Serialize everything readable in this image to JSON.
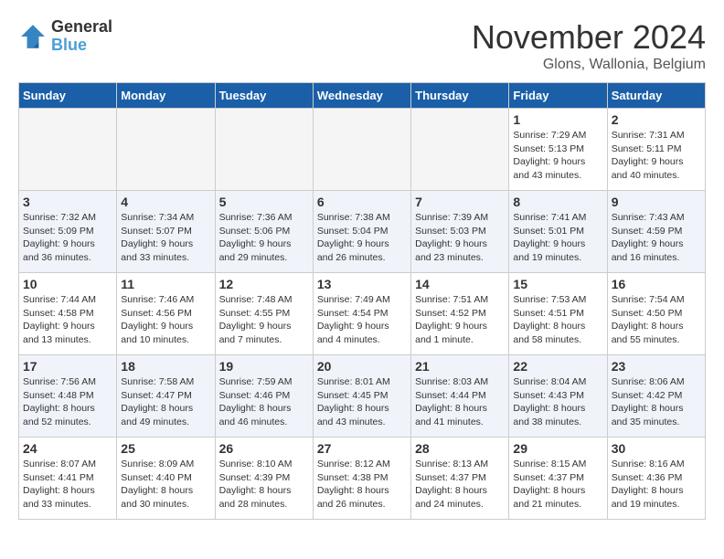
{
  "header": {
    "logo_line1": "General",
    "logo_line2": "Blue",
    "month_title": "November 2024",
    "subtitle": "Glons, Wallonia, Belgium"
  },
  "days_of_week": [
    "Sunday",
    "Monday",
    "Tuesday",
    "Wednesday",
    "Thursday",
    "Friday",
    "Saturday"
  ],
  "weeks": [
    [
      {
        "num": "",
        "info": ""
      },
      {
        "num": "",
        "info": ""
      },
      {
        "num": "",
        "info": ""
      },
      {
        "num": "",
        "info": ""
      },
      {
        "num": "",
        "info": ""
      },
      {
        "num": "1",
        "info": "Sunrise: 7:29 AM\nSunset: 5:13 PM\nDaylight: 9 hours\nand 43 minutes."
      },
      {
        "num": "2",
        "info": "Sunrise: 7:31 AM\nSunset: 5:11 PM\nDaylight: 9 hours\nand 40 minutes."
      }
    ],
    [
      {
        "num": "3",
        "info": "Sunrise: 7:32 AM\nSunset: 5:09 PM\nDaylight: 9 hours\nand 36 minutes."
      },
      {
        "num": "4",
        "info": "Sunrise: 7:34 AM\nSunset: 5:07 PM\nDaylight: 9 hours\nand 33 minutes."
      },
      {
        "num": "5",
        "info": "Sunrise: 7:36 AM\nSunset: 5:06 PM\nDaylight: 9 hours\nand 29 minutes."
      },
      {
        "num": "6",
        "info": "Sunrise: 7:38 AM\nSunset: 5:04 PM\nDaylight: 9 hours\nand 26 minutes."
      },
      {
        "num": "7",
        "info": "Sunrise: 7:39 AM\nSunset: 5:03 PM\nDaylight: 9 hours\nand 23 minutes."
      },
      {
        "num": "8",
        "info": "Sunrise: 7:41 AM\nSunset: 5:01 PM\nDaylight: 9 hours\nand 19 minutes."
      },
      {
        "num": "9",
        "info": "Sunrise: 7:43 AM\nSunset: 4:59 PM\nDaylight: 9 hours\nand 16 minutes."
      }
    ],
    [
      {
        "num": "10",
        "info": "Sunrise: 7:44 AM\nSunset: 4:58 PM\nDaylight: 9 hours\nand 13 minutes."
      },
      {
        "num": "11",
        "info": "Sunrise: 7:46 AM\nSunset: 4:56 PM\nDaylight: 9 hours\nand 10 minutes."
      },
      {
        "num": "12",
        "info": "Sunrise: 7:48 AM\nSunset: 4:55 PM\nDaylight: 9 hours\nand 7 minutes."
      },
      {
        "num": "13",
        "info": "Sunrise: 7:49 AM\nSunset: 4:54 PM\nDaylight: 9 hours\nand 4 minutes."
      },
      {
        "num": "14",
        "info": "Sunrise: 7:51 AM\nSunset: 4:52 PM\nDaylight: 9 hours\nand 1 minute."
      },
      {
        "num": "15",
        "info": "Sunrise: 7:53 AM\nSunset: 4:51 PM\nDaylight: 8 hours\nand 58 minutes."
      },
      {
        "num": "16",
        "info": "Sunrise: 7:54 AM\nSunset: 4:50 PM\nDaylight: 8 hours\nand 55 minutes."
      }
    ],
    [
      {
        "num": "17",
        "info": "Sunrise: 7:56 AM\nSunset: 4:48 PM\nDaylight: 8 hours\nand 52 minutes."
      },
      {
        "num": "18",
        "info": "Sunrise: 7:58 AM\nSunset: 4:47 PM\nDaylight: 8 hours\nand 49 minutes."
      },
      {
        "num": "19",
        "info": "Sunrise: 7:59 AM\nSunset: 4:46 PM\nDaylight: 8 hours\nand 46 minutes."
      },
      {
        "num": "20",
        "info": "Sunrise: 8:01 AM\nSunset: 4:45 PM\nDaylight: 8 hours\nand 43 minutes."
      },
      {
        "num": "21",
        "info": "Sunrise: 8:03 AM\nSunset: 4:44 PM\nDaylight: 8 hours\nand 41 minutes."
      },
      {
        "num": "22",
        "info": "Sunrise: 8:04 AM\nSunset: 4:43 PM\nDaylight: 8 hours\nand 38 minutes."
      },
      {
        "num": "23",
        "info": "Sunrise: 8:06 AM\nSunset: 4:42 PM\nDaylight: 8 hours\nand 35 minutes."
      }
    ],
    [
      {
        "num": "24",
        "info": "Sunrise: 8:07 AM\nSunset: 4:41 PM\nDaylight: 8 hours\nand 33 minutes."
      },
      {
        "num": "25",
        "info": "Sunrise: 8:09 AM\nSunset: 4:40 PM\nDaylight: 8 hours\nand 30 minutes."
      },
      {
        "num": "26",
        "info": "Sunrise: 8:10 AM\nSunset: 4:39 PM\nDaylight: 8 hours\nand 28 minutes."
      },
      {
        "num": "27",
        "info": "Sunrise: 8:12 AM\nSunset: 4:38 PM\nDaylight: 8 hours\nand 26 minutes."
      },
      {
        "num": "28",
        "info": "Sunrise: 8:13 AM\nSunset: 4:37 PM\nDaylight: 8 hours\nand 24 minutes."
      },
      {
        "num": "29",
        "info": "Sunrise: 8:15 AM\nSunset: 4:37 PM\nDaylight: 8 hours\nand 21 minutes."
      },
      {
        "num": "30",
        "info": "Sunrise: 8:16 AM\nSunset: 4:36 PM\nDaylight: 8 hours\nand 19 minutes."
      }
    ]
  ]
}
